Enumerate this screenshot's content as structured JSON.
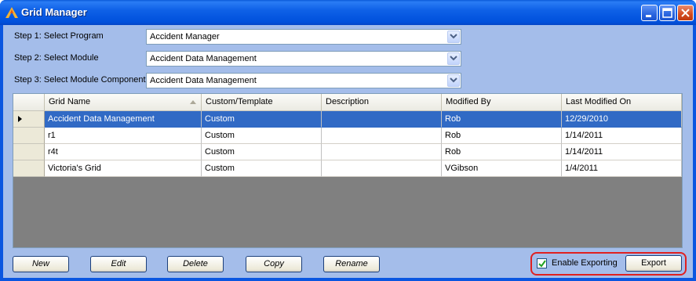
{
  "window": {
    "title": "Grid Manager"
  },
  "steps": [
    {
      "label": "Step 1: Select Program",
      "value": "Accident Manager"
    },
    {
      "label": "Step 2: Select Module",
      "value": "Accident Data Management"
    },
    {
      "label": "Step 3: Select Module Component",
      "value": "Accident Data Management"
    }
  ],
  "grid": {
    "columns": [
      "Grid Name",
      "Custom/Template",
      "Description",
      "Modified By",
      "Last Modified On"
    ],
    "sorted_column": "Grid Name",
    "rows": [
      [
        "Accident Data Management",
        "Custom",
        "",
        "Rob",
        "12/29/2010"
      ],
      [
        "r1",
        "Custom",
        "",
        "Rob",
        "1/14/2011"
      ],
      [
        "r4t",
        "Custom",
        "",
        "Rob",
        "1/14/2011"
      ],
      [
        "Victoria's Grid",
        "Custom",
        "",
        "VGibson",
        "1/4/2011"
      ]
    ],
    "selected_row": 0
  },
  "buttons": {
    "new": "New",
    "edit": "Edit",
    "delete": "Delete",
    "copy": "Copy",
    "rename": "Rename",
    "export": "Export"
  },
  "export": {
    "checkbox_label": "Enable Exporting",
    "checked": true
  },
  "icons": {
    "app": "grid-manager-app-icon",
    "minimize": "minimize-icon",
    "maximize": "maximize-icon",
    "close": "close-icon",
    "dropdown": "chevron-down-icon",
    "row_marker": "row-pointer-icon",
    "sort": "sort-ascending-icon"
  },
  "colors": {
    "titlebar": "#0a56e0",
    "client_bg": "#a4bdea",
    "selection": "#316ac5",
    "highlight_outline": "#e02020"
  }
}
